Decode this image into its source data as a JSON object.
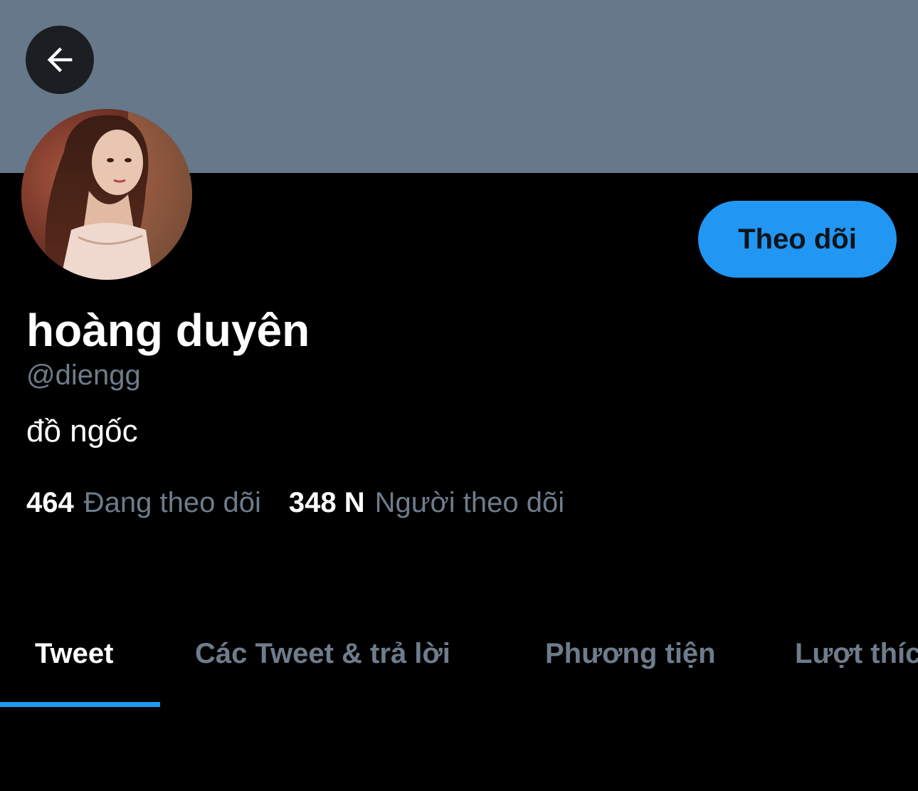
{
  "header": {
    "banner_color": "#66788a",
    "back_icon": "arrow-left-icon"
  },
  "profile": {
    "display_name": "hoàng duyên",
    "handle": "@diengg",
    "bio": "đồ ngốc",
    "follow_button_label": "Theo dõi",
    "avatar_icon": "avatar-photo"
  },
  "stats": {
    "following_count": "464",
    "following_label": "Đang theo dõi",
    "followers_count": "348 N",
    "followers_label": "Người theo dõi"
  },
  "tabs": [
    {
      "label": "Tweet",
      "active": true
    },
    {
      "label": "Các Tweet & trả lời",
      "active": false
    },
    {
      "label": "Phương tiện",
      "active": false
    },
    {
      "label": "Lượt thích",
      "active": false
    }
  ],
  "colors": {
    "accent": "#1d9bf0",
    "follow_button": "#2196f3",
    "secondary_text": "#6e7c8b",
    "background": "#000000"
  }
}
